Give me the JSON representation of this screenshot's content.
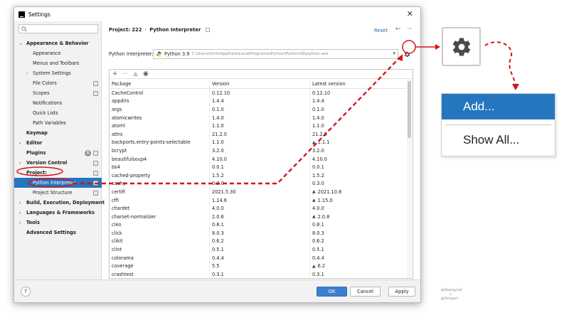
{
  "window": {
    "title": "Settings",
    "close_glyph": "✕"
  },
  "sidebar": {
    "search_placeholder": "",
    "items": [
      {
        "label": "Appearance & Behavior",
        "level": 0,
        "bold": true,
        "arrow": "⌄"
      },
      {
        "label": "Appearance",
        "level": 1
      },
      {
        "label": "Menus and Toolbars",
        "level": 1
      },
      {
        "label": "System Settings",
        "level": 1,
        "arrow": "›"
      },
      {
        "label": "File Colors",
        "level": 1,
        "badge": true
      },
      {
        "label": "Scopes",
        "level": 1,
        "badge": true
      },
      {
        "label": "Notifications",
        "level": 1
      },
      {
        "label": "Quick Lists",
        "level": 1
      },
      {
        "label": "Path Variables",
        "level": 1
      },
      {
        "label": "Keymap",
        "level": 0,
        "bold": true
      },
      {
        "label": "Editor",
        "level": 0,
        "bold": true,
        "arrow": "›"
      },
      {
        "label": "Plugins",
        "level": 0,
        "bold": true,
        "count": "1",
        "badge": true
      },
      {
        "label": "Version Control",
        "level": 0,
        "bold": true,
        "arrow": "›",
        "badge": true
      },
      {
        "label": "Project:",
        "level": 0,
        "bold": true,
        "arrow": "⌄",
        "badge": true
      },
      {
        "label": "Python Interpreter",
        "level": 1,
        "selected": true,
        "badge": true
      },
      {
        "label": "Project Structure",
        "level": 1,
        "badge": true
      },
      {
        "label": "Build, Execution, Deployment",
        "level": 0,
        "bold": true,
        "arrow": "›"
      },
      {
        "label": "Languages & Frameworks",
        "level": 0,
        "bold": true,
        "arrow": "›"
      },
      {
        "label": "Tools",
        "level": 0,
        "bold": true,
        "arrow": "›"
      },
      {
        "label": "Advanced Settings",
        "level": 0,
        "bold": true
      }
    ]
  },
  "header": {
    "breadcrumb_project": "Project: 222",
    "breadcrumb_sep": "›",
    "breadcrumb_page": "Python Interpreter",
    "reset_label": "Reset",
    "back_glyph": "←",
    "forward_glyph": "→"
  },
  "interpreter": {
    "label": "Python Interpreter:",
    "name": "Python 3.9",
    "path": "C:\\Users\\tlmit\\AppData\\Local\\Programs\\Python\\Python39\\python.exe",
    "caret": "▾"
  },
  "toolbar": {
    "add": "+",
    "remove": "−",
    "upgrade": "▲",
    "eye": "◉"
  },
  "table": {
    "headers": {
      "package": "Package",
      "version": "Version",
      "latest": "Latest version"
    },
    "rows": [
      {
        "package": "CacheControl",
        "version": "0.12.10",
        "latest": "0.12.10",
        "upgrade": false
      },
      {
        "package": "appdirs",
        "version": "1.4.4",
        "latest": "1.4.4",
        "upgrade": false
      },
      {
        "package": "args",
        "version": "0.1.0",
        "latest": "0.1.0",
        "upgrade": false
      },
      {
        "package": "atomicwrites",
        "version": "1.4.0",
        "latest": "1.4.0",
        "upgrade": false
      },
      {
        "package": "atoml",
        "version": "1.1.0",
        "latest": "1.1.0",
        "upgrade": false
      },
      {
        "package": "attrs",
        "version": "21.2.0",
        "latest": "21.2.0",
        "upgrade": false
      },
      {
        "package": "backports.entry-points-selectable",
        "version": "1.1.0",
        "latest": "1.1.1",
        "upgrade": true
      },
      {
        "package": "bcrypt",
        "version": "3.2.0",
        "latest": "3.2.0",
        "upgrade": false
      },
      {
        "package": "beautifulsoup4",
        "version": "4.10.0",
        "latest": "4.10.0",
        "upgrade": false
      },
      {
        "package": "bs4",
        "version": "0.0.1",
        "latest": "0.0.1",
        "upgrade": false
      },
      {
        "package": "cached-property",
        "version": "1.5.2",
        "latest": "1.5.2",
        "upgrade": false
      },
      {
        "package": "cachy",
        "version": "0.3.0",
        "latest": "0.3.0",
        "upgrade": false
      },
      {
        "package": "certifi",
        "version": "2021.5.30",
        "latest": "2021.10.8",
        "upgrade": true
      },
      {
        "package": "cffi",
        "version": "1.14.6",
        "latest": "1.15.0",
        "upgrade": true
      },
      {
        "package": "chardet",
        "version": "4.0.0",
        "latest": "4.0.0",
        "upgrade": false
      },
      {
        "package": "charset-normalizer",
        "version": "2.0.6",
        "latest": "2.0.8",
        "upgrade": true
      },
      {
        "package": "cleo",
        "version": "0.8.1",
        "latest": "0.8.1",
        "upgrade": false
      },
      {
        "package": "click",
        "version": "8.0.3",
        "latest": "8.0.3",
        "upgrade": false
      },
      {
        "package": "clikit",
        "version": "0.6.2",
        "latest": "0.6.2",
        "upgrade": false
      },
      {
        "package": "clint",
        "version": "0.5.1",
        "latest": "0.5.1",
        "upgrade": false
      },
      {
        "package": "colorama",
        "version": "0.4.4",
        "latest": "0.4.4",
        "upgrade": false
      },
      {
        "package": "coverage",
        "version": "5.5",
        "latest": "6.2",
        "upgrade": true
      },
      {
        "package": "crashtest",
        "version": "0.3.1",
        "latest": "0.3.1",
        "upgrade": false
      }
    ]
  },
  "footer": {
    "help": "?",
    "ok": "OK",
    "cancel": "Cancel",
    "apply": "Apply"
  },
  "callout": {
    "add": "Add...",
    "show_all": "Show All..."
  },
  "watermark": {
    "line1": "@Danny2id",
    "line2": "x",
    "line3": "@Serpari"
  },
  "colors": {
    "accent": "#2675bf",
    "annotation": "#d4141c"
  }
}
